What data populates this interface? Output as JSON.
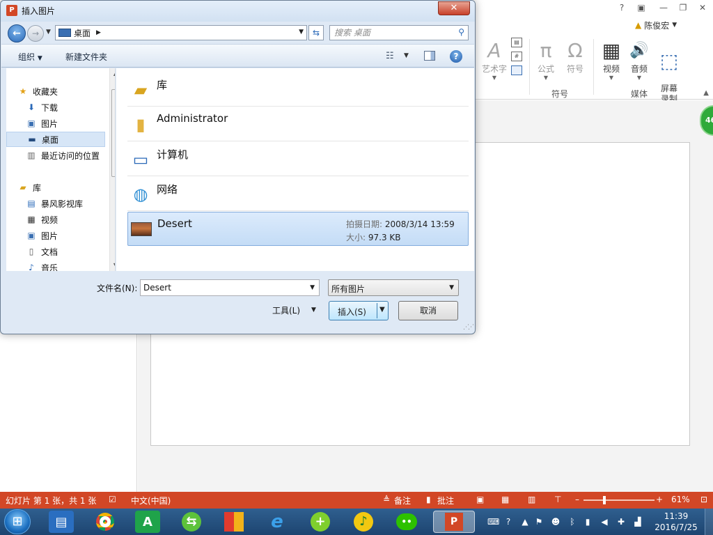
{
  "powerpoint": {
    "window_controls": [
      "?",
      "▣",
      "—",
      "❐",
      "✕"
    ],
    "user_name": "陈俊宏",
    "ribbon": {
      "items": [
        {
          "label": "艺术字",
          "icon": "A"
        },
        {
          "label": "公式",
          "icon": "π"
        },
        {
          "label": "符号",
          "icon": "Ω"
        },
        {
          "label": "视频",
          "icon": "▦"
        },
        {
          "label": "音频",
          "icon": "🔊"
        },
        {
          "label": "屏幕\n录制",
          "icon": "⬚"
        }
      ],
      "groups": {
        "symbols": "符号",
        "media": "媒体"
      }
    },
    "badge_number": "46",
    "statusbar": {
      "slide_info": "幻灯片 第 1 张，共 1 张",
      "language": "中文(中国)",
      "notes": "备注",
      "comments": "批注",
      "zoom": "61%",
      "zoom_level": 0.61
    }
  },
  "taskbar": {
    "time": "11:39",
    "date": "2016/7/25"
  },
  "dialog": {
    "title": "插入图片",
    "close_label": "✕",
    "address": {
      "location": "桌面"
    },
    "search": {
      "placeholder": "搜索 桌面"
    },
    "toolbar": {
      "organize": "组织",
      "new_folder": "新建文件夹"
    },
    "nav": {
      "favorites": "收藏夹",
      "downloads": "下载",
      "pictures": "图片",
      "desktop": "桌面",
      "recent": "最近访问的位置",
      "libraries": "库",
      "storm_library": "暴风影视库",
      "videos": "视频",
      "pictures2": "图片",
      "documents": "文档",
      "music": "音乐"
    },
    "files": [
      {
        "name": "库"
      },
      {
        "name": "Administrator"
      },
      {
        "name": "计算机"
      },
      {
        "name": "网络"
      },
      {
        "name": "Desert",
        "date_label": "拍摄日期:",
        "date": "2008/3/14 13:59",
        "size_label": "大小:",
        "size": "97.3 KB"
      }
    ],
    "filename_label": "文件名(N):",
    "filename_value": "Desert",
    "filter_value": "所有图片",
    "tools_label": "工具(L)",
    "insert_label": "插入(S)",
    "cancel_label": "取消"
  }
}
